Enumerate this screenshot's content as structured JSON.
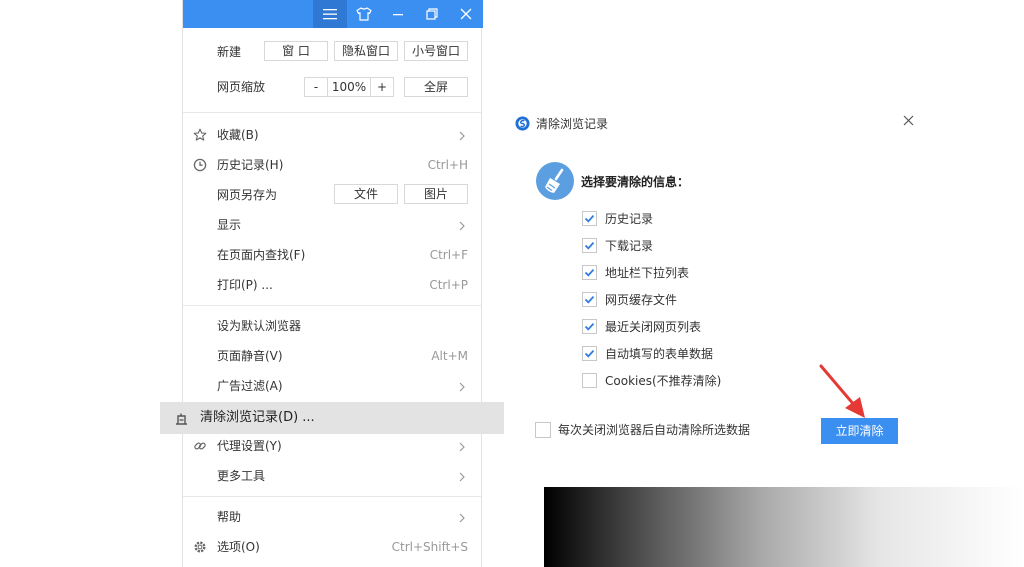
{
  "colors": {
    "accent": "#3b8ff0",
    "highlight": "#e3e3e3",
    "arrow": "#e53935"
  },
  "titlebar": {
    "icons": [
      "menu-icon",
      "skin-icon",
      "minimize-icon",
      "restore-icon",
      "close-icon"
    ]
  },
  "menu": {
    "new": {
      "label": "新建",
      "window": "窗 口",
      "private": "隐私窗口",
      "mini": "小号窗口"
    },
    "zoom": {
      "label": "网页缩放",
      "minus": "-",
      "value": "100%",
      "plus": "+",
      "fullscreen": "全屏"
    },
    "favorites": {
      "label": "收藏(B)"
    },
    "history": {
      "label": "历史记录(H)",
      "shortcut": "Ctrl+H"
    },
    "save_as": {
      "label": "网页另存为",
      "file": "文件",
      "image": "图片"
    },
    "display": {
      "label": "显示"
    },
    "find": {
      "label": "在页面内查找(F)",
      "shortcut": "Ctrl+F"
    },
    "print": {
      "label": "打印(P) ...",
      "shortcut": "Ctrl+P"
    },
    "default_browser": {
      "label": "设为默认浏览器"
    },
    "mute": {
      "label": "页面静音(V)",
      "shortcut": "Alt+M"
    },
    "adblock": {
      "label": "广告过滤(A)"
    },
    "clear_history": {
      "label": "清除浏览记录(D) ..."
    },
    "proxy": {
      "label": "代理设置(Y)"
    },
    "more_tools": {
      "label": "更多工具"
    },
    "help": {
      "label": "帮助"
    },
    "options": {
      "label": "选项(O)",
      "shortcut": "Ctrl+Shift+S"
    }
  },
  "dialog": {
    "title": "清除浏览记录",
    "heading": "选择要清除的信息：",
    "options": [
      {
        "label": "历史记录",
        "checked": true
      },
      {
        "label": "下载记录",
        "checked": true
      },
      {
        "label": "地址栏下拉列表",
        "checked": true
      },
      {
        "label": "网页缓存文件",
        "checked": true
      },
      {
        "label": "最近关闭网页列表",
        "checked": true
      },
      {
        "label": "自动填写的表单数据",
        "checked": true
      },
      {
        "label": "Cookies(不推荐清除)",
        "checked": false
      }
    ],
    "auto_clear": {
      "label": "每次关闭浏览器后自动清除所选数据",
      "checked": false
    },
    "clear_button": "立即清除"
  }
}
